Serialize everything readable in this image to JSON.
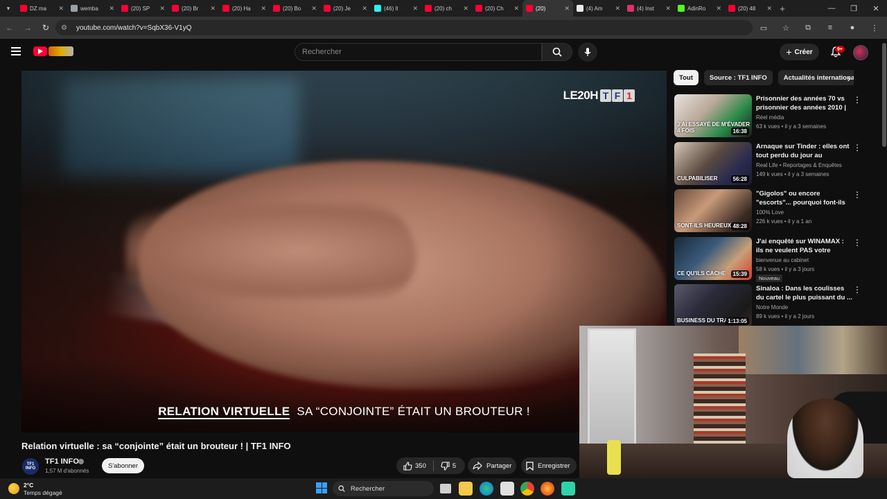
{
  "browser": {
    "tabs": [
      {
        "label": "DZ ma",
        "color": "#ff0033"
      },
      {
        "label": "wemba",
        "color": "#9aa0a6"
      },
      {
        "label": "(20) SP",
        "color": "#ff0033"
      },
      {
        "label": "(20) Br",
        "color": "#ff0033"
      },
      {
        "label": "(20) Ha",
        "color": "#ff0033"
      },
      {
        "label": "(20) Bo",
        "color": "#ff0033"
      },
      {
        "label": "(20) Je",
        "color": "#ff0033"
      },
      {
        "label": "(46) Il",
        "color": "#25f4ee"
      },
      {
        "label": "(20) ch",
        "color": "#ff0033"
      },
      {
        "label": "(20) Ch",
        "color": "#ff0033"
      },
      {
        "label": "(20)",
        "color": "#ff0033"
      },
      {
        "label": "(4) Am",
        "color": "#e7e9ea"
      },
      {
        "label": "(4) Inst",
        "color": "#e1306c"
      },
      {
        "label": "AdinRo",
        "color": "#53fc18"
      },
      {
        "label": "(20) 48",
        "color": "#ff0033"
      }
    ],
    "active_tab_index": 10,
    "url": "youtube.com/watch?v=SqbX36-V1yQ"
  },
  "masthead": {
    "search_placeholder": "Rechercher",
    "create_label": "Créer",
    "notification_count": "9+"
  },
  "player": {
    "watermark_prefix": "LE20H",
    "watermark_brand": [
      "T",
      "F",
      "1"
    ],
    "caption_part1": "RELATION VIRTUELLE",
    "caption_part2": "SA “CONJOINTE” ÉTAIT UN BROUTEUR !"
  },
  "video": {
    "title": "Relation virtuelle : sa “conjointe” était un brouteur ! | TF1 INFO",
    "channel_name": "TF1 INFO",
    "channel_logo_text": "TF1 INFO",
    "subscribers": "1,57 M d'abonnés",
    "subscribe_label": "S'abonner",
    "likes": "350",
    "dislikes": "5",
    "share_label": "Partager",
    "save_label": "Enregistrer"
  },
  "sidebar": {
    "chips": [
      "Tout",
      "Source : TF1 INFO",
      "Actualités internationales"
    ],
    "recommendations": [
      {
        "title": "Prisonnier des années 70 vs prisonnier des années 2010 | ...",
        "channel": "Réel média",
        "meta": "63 k vues • il y a 3 semaines",
        "duration": "16:38",
        "thumb_text": "J'AI ESSAYÉ DE M'ÉVADER 4 FOIS",
        "badge": ""
      },
      {
        "title": "Arnaque sur Tinder : elles ont tout perdu du jour au lendemain",
        "channel": "Real Life • Reportages & Enquêtes",
        "meta": "149 k vues • il y a 3 semaines",
        "duration": "56:28",
        "thumb_text": "CULPABILISER",
        "badge": ""
      },
      {
        "title": "\"Gigolos\" ou encore \"escorts\"... pourquoi font-ils ce métier ?",
        "channel": "100% Love",
        "meta": "226 k vues • il y a 1 an",
        "duration": "48:28",
        "thumb_text": "SONT-ILS HEUREUX ?",
        "badge": ""
      },
      {
        "title": "J'ai enquêté sur WINAMAX : ils ne veulent PAS votre argent...",
        "channel": "bienvenue au cabinet",
        "meta": "58 k vues • il y a 3 jours",
        "duration": "15:39",
        "thumb_text": "CE QU'ILS CACHE",
        "badge": "Nouveau"
      },
      {
        "title": "Sinaloa : Dans les coulisses du cartel le plus puissant du ...",
        "channel": "Notre Monde",
        "meta": "89 k vues • il y a 2 jours",
        "duration": "1:13:05",
        "thumb_text": "BUSINESS DU TRAFI",
        "badge": ""
      }
    ]
  },
  "taskbar": {
    "temperature": "2°C",
    "weather": "Temps dégagé",
    "search_label": "Rechercher"
  }
}
